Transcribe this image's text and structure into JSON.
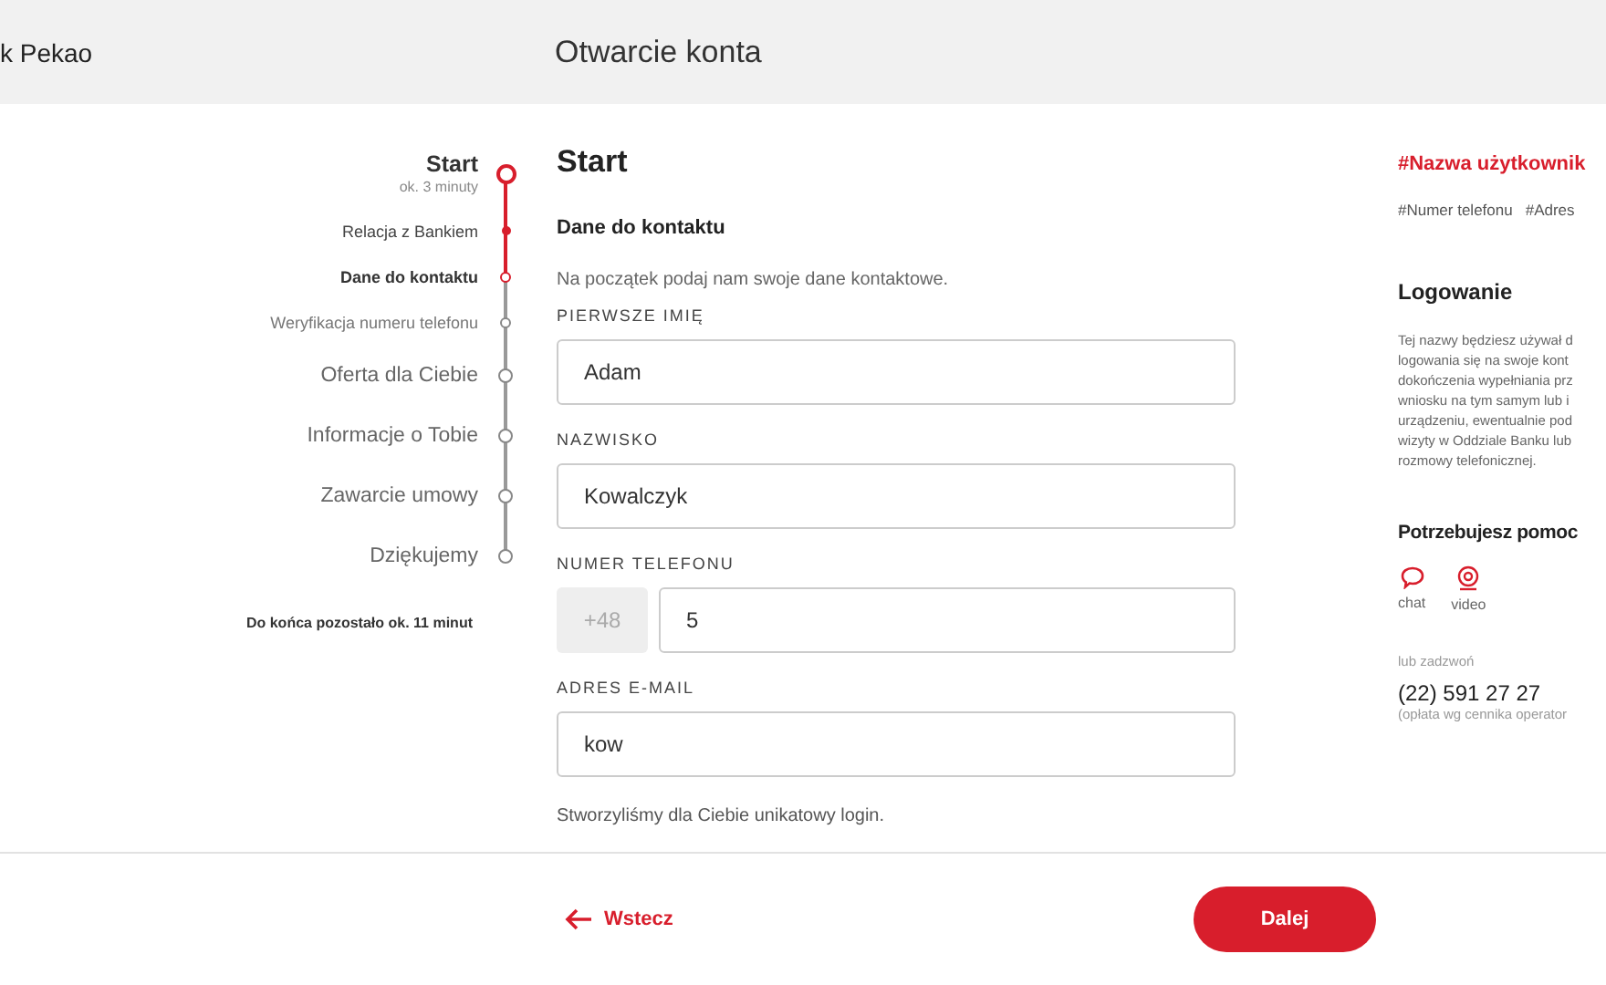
{
  "header": {
    "brand": "k Pekao",
    "title": "Otwarcie konta"
  },
  "steps": [
    {
      "label": "Start",
      "note": "ok. 3 minuty",
      "kind": "major",
      "done": false,
      "current": true
    },
    {
      "label": "Relacja z Bankiem",
      "kind": "minor",
      "done": true,
      "current": false
    },
    {
      "label": "Dane do kontaktu",
      "kind": "minor",
      "done": false,
      "current": true
    },
    {
      "label": "Weryfikacja numeru telefonu",
      "kind": "minor",
      "done": false,
      "current": false
    },
    {
      "label": "Oferta dla Ciebie",
      "kind": "major",
      "done": false,
      "current": false
    },
    {
      "label": "Informacje o Tobie",
      "kind": "major",
      "done": false,
      "current": false
    },
    {
      "label": "Zawarcie umowy",
      "kind": "major",
      "done": false,
      "current": false
    },
    {
      "label": "Dziękujemy",
      "kind": "major",
      "done": false,
      "current": false
    }
  ],
  "remaining": "Do końca pozostało ok. 11 minut",
  "form": {
    "title": "Start",
    "section": "Dane do kontaktu",
    "intro": "Na początek podaj nam swoje dane kontaktowe.",
    "fields": [
      {
        "label": "PIERWSZE IMIĘ",
        "value": "Adam",
        "kind": "text"
      },
      {
        "label": "NAZWISKO",
        "value": "Kowalczyk",
        "kind": "text"
      },
      {
        "label": "NUMER TELEFONU",
        "prefix": "+48",
        "value": "5",
        "kind": "phone"
      },
      {
        "label": "ADRES E-MAIL",
        "value": "kow",
        "kind": "text"
      }
    ],
    "note": "Stworzyliśmy dla Ciebie unikatowy login."
  },
  "aside": {
    "username": "#Nazwa użytkownik",
    "tags": [
      "#Numer telefonu",
      "#Adres"
    ],
    "login_title": "Logowanie",
    "login_lines": [
      "Tej nazwy będziesz używał d",
      "logowania się na swoje kont",
      "dokończenia wypełniania prz",
      "wniosku na tym samym lub i",
      "urządzeniu, ewentualnie pod",
      "wizyty w Oddziale Banku lub",
      "rozmowy telefonicznej."
    ],
    "help_title": "Potrzebujesz pomoc",
    "contacts": [
      {
        "label": "chat",
        "kind": "chat"
      },
      {
        "label": "video",
        "kind": "video"
      }
    ],
    "call_label": "lub zadzwoń",
    "phone": "(22) 591 27 27",
    "fee": "(opłata wg cennika operator"
  },
  "footer": {
    "back": "Wstecz",
    "next": "Dalej"
  }
}
